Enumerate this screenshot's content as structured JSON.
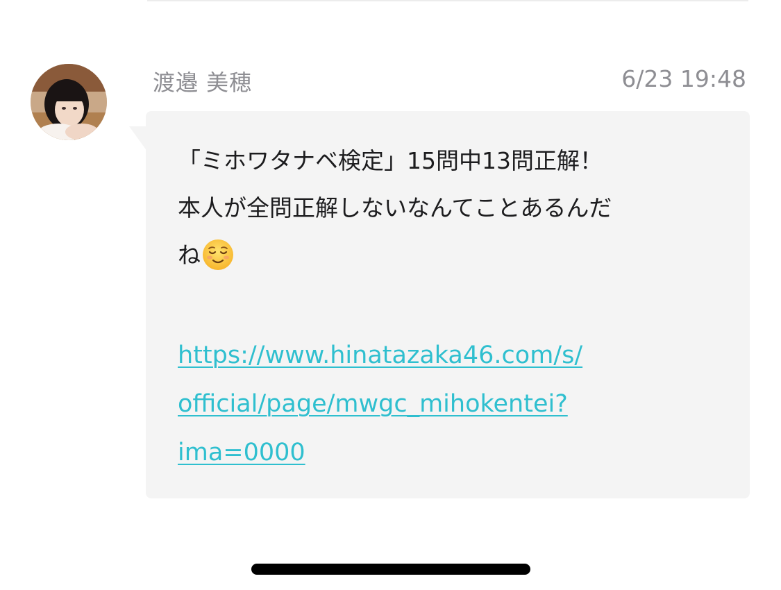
{
  "message": {
    "sender_name": "渡邉 美穂",
    "timestamp": "6/23 19:48",
    "avatar_icon": "member-avatar-photo",
    "lines": [
      "「ミホワタナベ検定」15問中13問正解！",
      "本人が全問正解しないなんてことあるんだ",
      "ね"
    ],
    "emoji": "relieved-face-icon",
    "link_lines": [
      "https://www.hinatazaka46.com/s/",
      "official/page/mwgc_mihokentei?",
      "ima=0000"
    ]
  },
  "colors": {
    "bubble_background": "#f4f4f4",
    "link": "#2fbfcf",
    "meta_text": "#8e8e93"
  }
}
